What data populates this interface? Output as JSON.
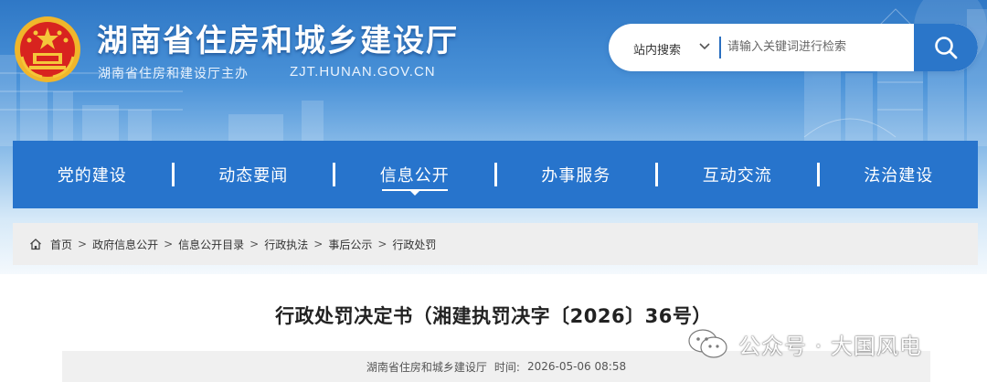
{
  "site": {
    "title": "湖南省住房和城乡建设厅",
    "host_org": "湖南省住房和建设厅主办",
    "domain": "ZJT.HUNAN.GOV.CN"
  },
  "search": {
    "scope": "站内搜索",
    "placeholder": "请输入关键词进行检索",
    "button_icon": "search-icon"
  },
  "nav": {
    "items": [
      {
        "label": "党的建设"
      },
      {
        "label": "动态要闻"
      },
      {
        "label": "信息公开",
        "active": true
      },
      {
        "label": "办事服务"
      },
      {
        "label": "互动交流"
      },
      {
        "label": "法治建设"
      }
    ]
  },
  "breadcrumb": {
    "icon": "home-icon",
    "items": [
      "首页",
      "政府信息公开",
      "信息公开目录",
      "行政执法",
      "事后公示",
      "行政处罚"
    ],
    "separator": ">"
  },
  "article": {
    "title": "行政处罚决定书（湘建执罚决字〔2026〕36号）",
    "source": "湖南省住房和城乡建设厅",
    "time_label": "时间:",
    "time": "2026-05-06 08:58"
  },
  "watermark": {
    "icon": "wechat-icon",
    "text": "公众号 · 大国风电"
  },
  "colors": {
    "nav_bg": "#2774cc",
    "search_button": "#2b76c9",
    "header_top": "#2f78c6"
  }
}
